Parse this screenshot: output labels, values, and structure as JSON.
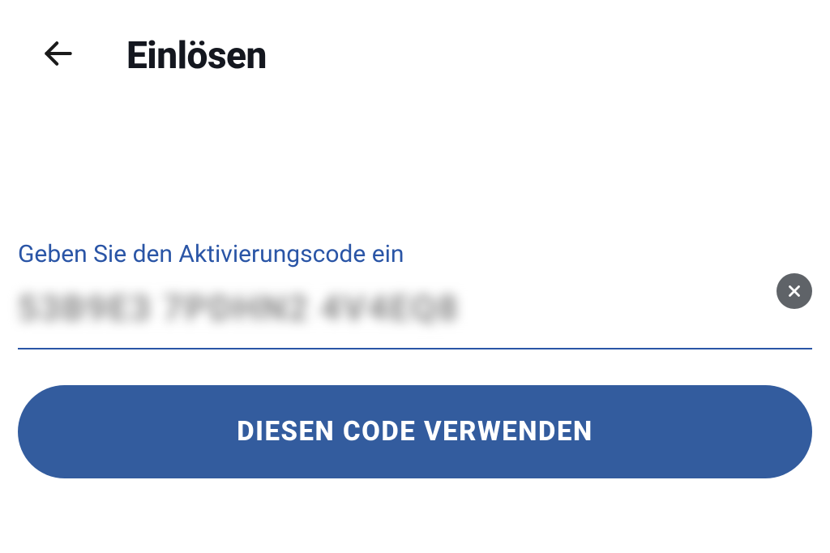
{
  "header": {
    "title": "Einlösen"
  },
  "form": {
    "input_label": "Geben Sie den Aktivierungscode ein",
    "input_value": "53B9E3 7PDHN2 4V4EQ8",
    "submit_label": "DIESEN CODE VERWENDEN"
  }
}
